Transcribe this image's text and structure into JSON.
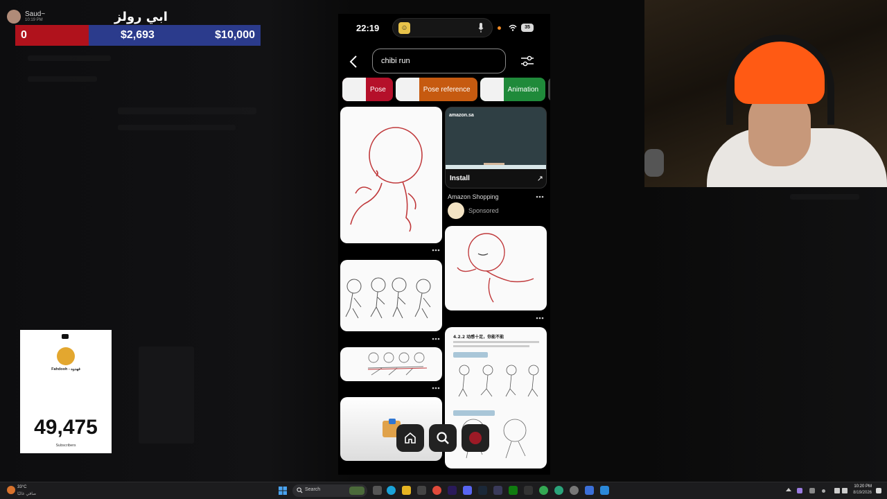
{
  "donation": {
    "username": "Saud~",
    "time": "10:19 PM",
    "title": "ابي رولز",
    "current": "0",
    "raised": "$2,693",
    "goal": "$10,000",
    "progress_fraction": 0.269,
    "colors": {
      "fill": "#b0121c",
      "track": "#2b3b8c"
    }
  },
  "phone": {
    "status": {
      "time": "22:19",
      "battery": "35"
    },
    "search": {
      "value": "chibi run"
    },
    "chips": [
      {
        "label": "Pose",
        "color": "#b5102a"
      },
      {
        "label": "Pose reference",
        "color": "#c65a10"
      },
      {
        "label": "Animation",
        "color": "#1f8a3a"
      }
    ],
    "ad": {
      "logo": "amazon.sa",
      "install_label": "Install",
      "brand": "Amazon Shopping",
      "sponsored": "Sponsored"
    },
    "book_page": {
      "heading": "4.2.2 动感十足，你能不能"
    },
    "dock": [
      "home-icon",
      "search-icon",
      "profile-icon"
    ]
  },
  "subscribers": {
    "name": "Fahdooh - فهدوه",
    "count": "49,475",
    "label": "Subscribers"
  },
  "taskbar": {
    "weather_temp": "33°C",
    "weather_desc": "صافي غالبًا",
    "search_placeholder": "Search",
    "time": "10:20 PM",
    "date": "8/19/2026"
  }
}
